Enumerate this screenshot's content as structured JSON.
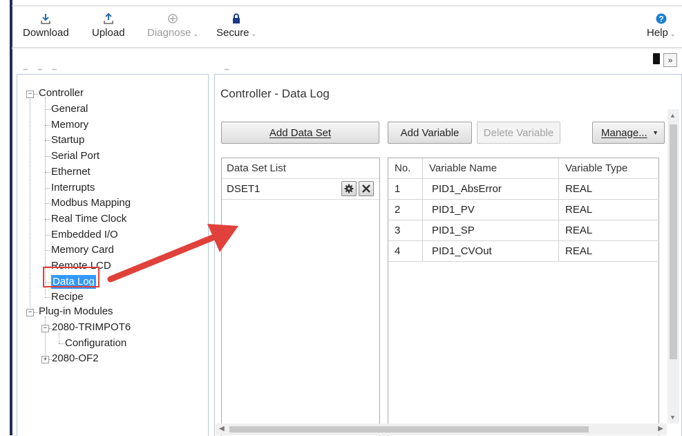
{
  "toolbar": {
    "download": "Download",
    "upload": "Upload",
    "diagnose": "Diagnose",
    "secure": "Secure",
    "help": "Help"
  },
  "tree": {
    "controller": "Controller",
    "items": [
      "General",
      "Memory",
      "Startup",
      "Serial Port",
      "Ethernet",
      "Interrupts",
      "Modbus Mapping",
      "Real Time Clock",
      "Embedded I/O",
      "Memory Card",
      "Remote LCD",
      "Data Log",
      "Recipe"
    ],
    "plugins": "Plug-in Modules",
    "trimpot": "2080-TRIMPOT6",
    "configuration": "Configuration",
    "of2": "2080-OF2",
    "selected": "Data Log"
  },
  "main": {
    "title": "Controller - Data Log",
    "add_data_set": "Add Data Set",
    "add_variable": "Add Variable",
    "delete_variable": "Delete Variable",
    "manage": "Manage..."
  },
  "dataset_list": {
    "header": "Data Set List",
    "rows": [
      "DSET1"
    ]
  },
  "variables": {
    "headers": [
      "No.",
      "Variable Name",
      "Variable Type"
    ],
    "rows": [
      [
        "1",
        "PID1_AbsError",
        "REAL"
      ],
      [
        "2",
        "PID1_PV",
        "REAL"
      ],
      [
        "3",
        "PID1_SP",
        "REAL"
      ],
      [
        "4",
        "PID1_CVOut",
        "REAL"
      ]
    ]
  },
  "colors": {
    "annotation_red": "#e0413a",
    "selection_blue": "#3399ff",
    "help_blue": "#1a7fd4"
  }
}
